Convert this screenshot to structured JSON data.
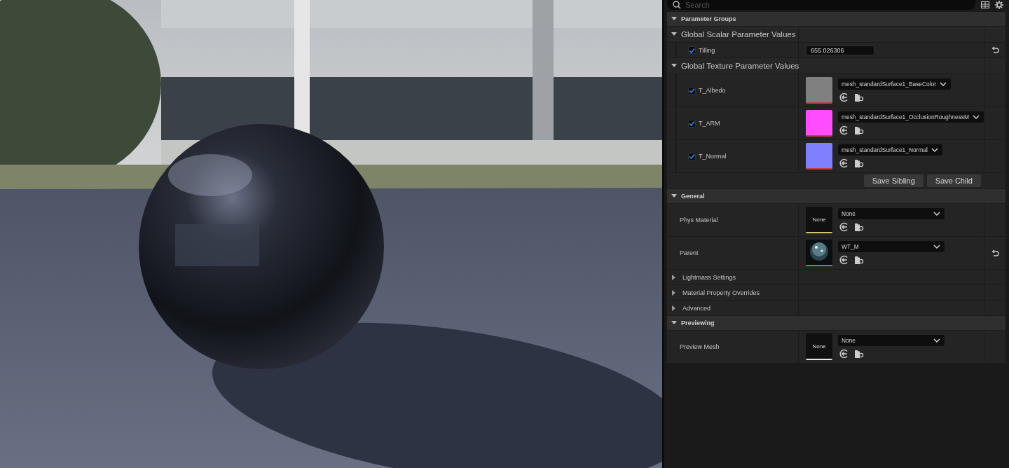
{
  "search": {
    "placeholder": "Search"
  },
  "categories": [
    {
      "title": "Parameter Groups",
      "expanded": true,
      "groups": [
        {
          "title": "Global Scalar Parameter Values",
          "expanded": true,
          "params": [
            {
              "kind": "scalar",
              "name": "Tilling",
              "checked": true,
              "value": "655.026306",
              "resettable": true
            }
          ]
        },
        {
          "title": "Global Texture Parameter Values",
          "expanded": true,
          "params": [
            {
              "kind": "texture",
              "name": "T_Albedo",
              "checked": true,
              "color": "#808080",
              "asset": "mesh_standardSurface1_BaseColor",
              "resettable": false
            },
            {
              "kind": "texture",
              "name": "T_ARM",
              "checked": true,
              "color": "#ff4cff",
              "asset": "mesh_standardSurface1_OcclusionRoughnessM",
              "resettable": false
            },
            {
              "kind": "texture",
              "name": "T_Normal",
              "checked": true,
              "color": "#8080ff",
              "asset": "mesh_standardSurface1_Normal",
              "resettable": false
            }
          ]
        }
      ],
      "buttons": [
        "Save Sibling",
        "Save Child"
      ]
    },
    {
      "title": "General",
      "expanded": true,
      "properties": [
        {
          "kind": "asset",
          "name": "Phys Material",
          "thumbnail": "None",
          "value": "None",
          "color": "#d8c66a",
          "resettable": false
        },
        {
          "kind": "asset",
          "name": "Parent",
          "value": "WT_M",
          "color": "#2ea84a",
          "resettable": true
        }
      ],
      "subcategories": [
        {
          "title": "Lightmass Settings",
          "expanded": false
        },
        {
          "title": "Material Property Overrides",
          "expanded": false
        },
        {
          "title": "Advanced",
          "expanded": false
        }
      ]
    },
    {
      "title": "Previewing",
      "expanded": true,
      "properties": [
        {
          "kind": "asset",
          "name": "Preview Mesh",
          "thumbnail": "None",
          "value": "None",
          "color": "#e8e8e8",
          "resettable": false
        }
      ]
    }
  ]
}
